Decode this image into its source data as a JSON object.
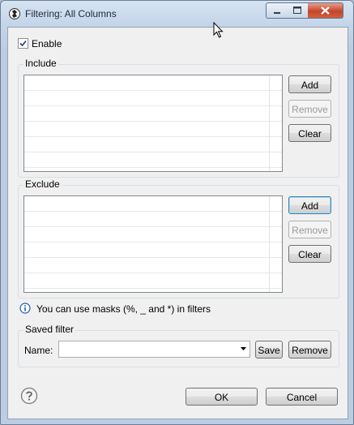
{
  "window": {
    "title": "Filtering: All Columns"
  },
  "enable": {
    "label": "Enable",
    "checked": true
  },
  "include": {
    "label": "Include",
    "add_label": "Add",
    "remove_label": "Remove",
    "clear_label": "Clear"
  },
  "exclude": {
    "label": "Exclude",
    "add_label": "Add",
    "remove_label": "Remove",
    "clear_label": "Clear"
  },
  "info": {
    "text": "You can use masks (%, _ and *) in filters"
  },
  "saved_filter": {
    "label": "Saved filter",
    "name_label": "Name:",
    "name_value": "",
    "save_label": "Save",
    "remove_label": "Remove"
  },
  "footer": {
    "ok_label": "OK",
    "cancel_label": "Cancel"
  },
  "colors": {
    "accent": "#3c7fb1",
    "close_button": "#c5442a",
    "info_icon": "#1f5fa8"
  }
}
